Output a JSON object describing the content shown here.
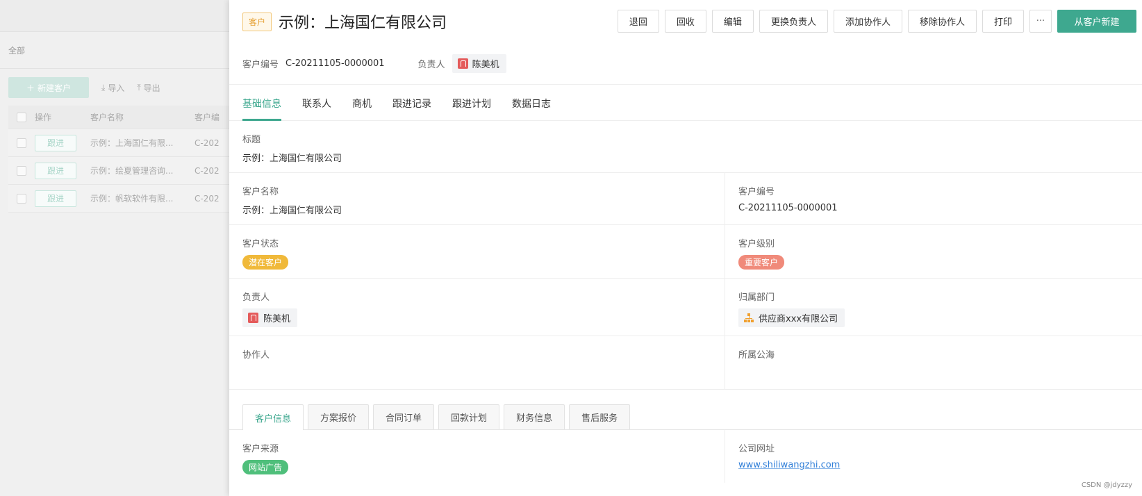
{
  "background_list": {
    "filter_label": "全部",
    "new_button": "新建客户",
    "import_label": "导入",
    "export_label": "导出",
    "columns": [
      "操作",
      "客户名称",
      "客户编"
    ],
    "rows": [
      {
        "action": "跟进",
        "name": "示例：上海国仁有限...",
        "code": "C-202"
      },
      {
        "action": "跟进",
        "name": "示例：绘夏管理咨询...",
        "code": "C-202"
      },
      {
        "action": "跟进",
        "name": "示例：帆软软件有限...",
        "code": "C-202"
      }
    ]
  },
  "drawer": {
    "type_tag": "客户",
    "title": "示例：上海国仁有限公司",
    "actions": {
      "back": "退回",
      "recycle": "回收",
      "edit": "编辑",
      "change_owner": "更换负责人",
      "add_collaborator": "添加协作人",
      "remove_collaborator": "移除协作人",
      "print": "打印",
      "more": "···",
      "new_from_customer": "从客户新建"
    },
    "meta": {
      "code_label": "客户编号",
      "code_value": "C-20211105-0000001",
      "owner_label": "负责人",
      "owner_value": "陈美机"
    },
    "tabs": [
      "基础信息",
      "联系人",
      "商机",
      "跟进记录",
      "跟进计划",
      "数据日志"
    ],
    "fields": {
      "title_label": "标题",
      "title_value": "示例：上海国仁有限公司",
      "name_label": "客户名称",
      "name_value": "示例：上海国仁有限公司",
      "number_label": "客户编号",
      "number_value": "C-20211105-0000001",
      "status_label": "客户状态",
      "status_value": "潜在客户",
      "level_label": "客户级别",
      "level_value": "重要客户",
      "owner_label": "负责人",
      "owner_value": "陈美机",
      "dept_label": "归属部门",
      "dept_value": "供应商xxx有限公司",
      "collab_label": "协作人",
      "collab_value": "",
      "pool_label": "所属公海",
      "pool_value": "",
      "source_label": "客户来源",
      "source_value": "网站广告",
      "website_label": "公司网址",
      "website_value": "www.shiliwangzhi.com"
    },
    "subtabs": [
      "客户信息",
      "方案报价",
      "合同订单",
      "回款计划",
      "财务信息",
      "售后服务"
    ]
  },
  "watermark": "CSDN @jdyzzy",
  "colors": {
    "accent": "#3ea88f",
    "status_pill": "#f0b93a",
    "level_pill": "#f08a7a",
    "source_pill": "#4fbf7b",
    "link": "#2f7ed8"
  }
}
